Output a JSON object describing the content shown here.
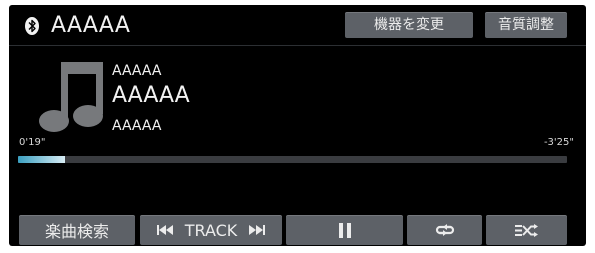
{
  "header": {
    "bluetooth_icon": "bluetooth-icon",
    "device_name": "AAAAA",
    "change_device_label": "機器を変更",
    "sound_adjust_label": "音質調整"
  },
  "now_playing": {
    "artwork_icon": "music-note-icon",
    "artist": "AAAAA",
    "title": "AAAAA",
    "album": "AAAAA",
    "elapsed": "0'19\"",
    "remaining": "-3'25\"",
    "progress_percent": 8.5
  },
  "controls": {
    "song_search_label": "楽曲検索",
    "track_label": "TRACK",
    "prev_icon": "previous-track-icon",
    "next_icon": "next-track-icon",
    "pause_icon": "pause-icon",
    "repeat_icon": "repeat-icon",
    "shuffle_icon": "shuffle-icon"
  },
  "colors": {
    "background": "#000000",
    "button": "#5d6167",
    "progress_accent": "#3b9fc0",
    "text": "#f2f2f2"
  }
}
